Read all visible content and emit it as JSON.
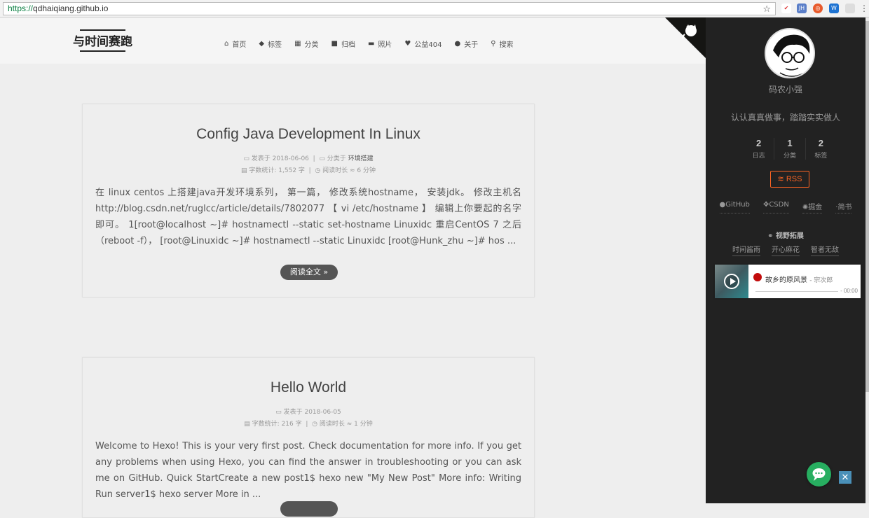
{
  "browser": {
    "url_proto": "https://",
    "url_host": "qdhaiqiang.github.io",
    "ext_labels": [
      "JH",
      "W"
    ]
  },
  "header": {
    "brand": "与时间赛跑",
    "nav": [
      {
        "icon": "home-icon",
        "label": "首页"
      },
      {
        "icon": "tags-icon",
        "label": "标签"
      },
      {
        "icon": "th-icon",
        "label": "分类"
      },
      {
        "icon": "archive-icon",
        "label": "归档"
      },
      {
        "icon": "folder-icon",
        "label": "照片"
      },
      {
        "icon": "heartbeat-icon",
        "label": "公益404"
      },
      {
        "icon": "user-icon",
        "label": "关于"
      },
      {
        "icon": "search-icon",
        "label": "搜索"
      }
    ]
  },
  "posts": [
    {
      "title": "Config Java Development In Linux",
      "posted_label": "发表于",
      "date": "2018-06-06",
      "category_label": "分类于",
      "category": "环境搭建",
      "words_label": "字数统计:",
      "words": "1,552 字",
      "reading_label": "阅读时长 ≈",
      "reading": "6 分钟",
      "excerpt": "在 linux centos 上搭建java开发环境系列， 第一篇， 修改系统hostname， 安装jdk。 修改主机名 http://blog.csdn.net/ruglcc/article/details/7802077 【 vi /etc/hostname 】 编辑上你要起的名字即可。 1[root@localhost ~]# hostnamectl --static set-hostname Linuxidc 重启CentOS 7 之后 （reboot -f）， [root@Linuxidc ~]# hostnamectl --static Linuxidc [root@Hunk_zhu ~]# hos ...",
      "read_more": "阅读全文 »"
    },
    {
      "title": "Hello World",
      "posted_label": "发表于",
      "date": "2018-06-05",
      "words_label": "字数统计:",
      "words": "216 字",
      "reading_label": "阅读时长 ≈",
      "reading": "1 分钟",
      "excerpt": "Welcome to Hexo! This is your very first post. Check documentation for more info. If you get any problems when using Hexo, you can find the answer in troubleshooting or you can ask me on GitHub. Quick StartCreate a new post1$ hexo new \"My New Post\" More info: Writing Run server1$ hexo server More in ..."
    }
  ],
  "sidebar": {
    "name": "码农小强",
    "description": "认认真真做事，踏踏实实做人",
    "stats": [
      {
        "num": "2",
        "label": "日志"
      },
      {
        "num": "1",
        "label": "分类"
      },
      {
        "num": "2",
        "label": "标签"
      }
    ],
    "rss": "RSS",
    "social": [
      {
        "icon": "github-icon",
        "label": "GitHub"
      },
      {
        "icon": "csdn-icon",
        "label": "CSDN"
      },
      {
        "icon": "juejin-icon",
        "label": "掘金"
      },
      {
        "icon": "jianshu-icon",
        "label": "简书"
      }
    ],
    "links_title": "视野拓展",
    "links": [
      "时间酱雨",
      "开心麻花",
      "智者无敌"
    ],
    "player": {
      "song": "故乡的原风景",
      "artist": "宗次郎",
      "time": "- 00:00"
    }
  },
  "colors": {
    "accent_rss": "#fc6423",
    "sidebar_bg": "#222222",
    "chat_green": "#27ae60"
  }
}
